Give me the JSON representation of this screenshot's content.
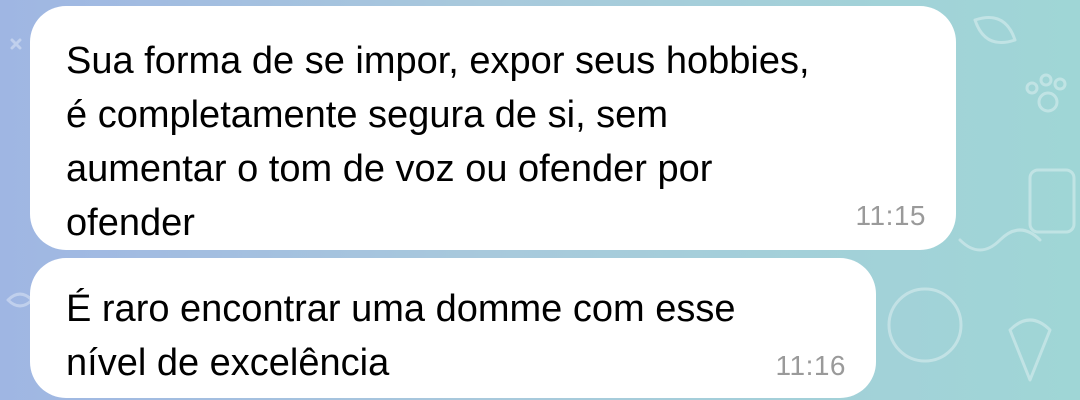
{
  "chat": {
    "messages": [
      {
        "text": "Sua forma de se impor, expor seus hobbies,\né completamente segura de si, sem\naumentar o tom de voz ou ofender por\nofender",
        "time": "11:15"
      },
      {
        "text": "É raro encontrar uma domme com esse\nnível de excelência",
        "time": "11:16"
      }
    ]
  },
  "colors": {
    "bubble": "#ffffff",
    "timestamp": "#9a9a9a",
    "wallpaper_left": "#9fb6e3",
    "wallpaper_right": "#9fd6d6"
  }
}
